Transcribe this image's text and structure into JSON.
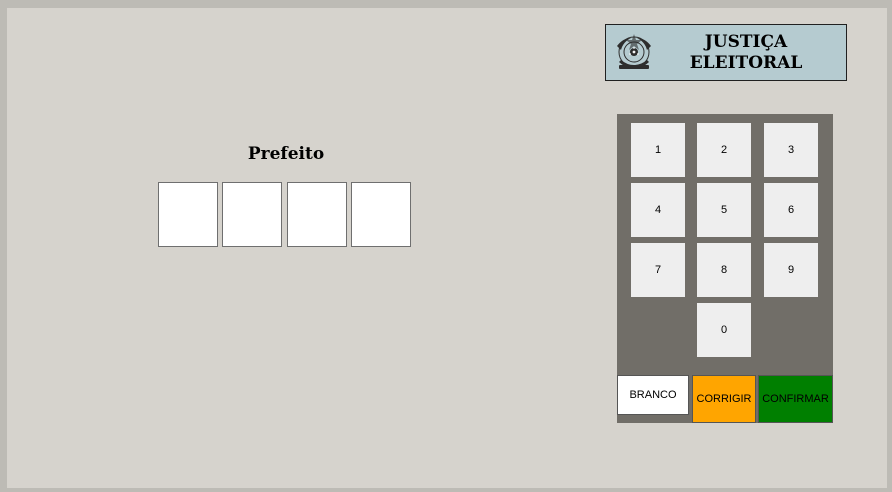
{
  "office": {
    "title": "Prefeito",
    "digits": [
      "",
      "",
      "",
      ""
    ]
  },
  "header": {
    "title_line1": "JUSTIÇA",
    "title_line2": "ELEITORAL",
    "seal_icon": "brasao-republica-icon"
  },
  "keypad": {
    "keys": [
      "1",
      "2",
      "3",
      "4",
      "5",
      "6",
      "7",
      "8",
      "9",
      "0"
    ]
  },
  "actions": {
    "branco": "BRANCO",
    "corrigir": "CORRIGIR",
    "confirmar": "CONFIRMAR"
  },
  "colors": {
    "screen_bg": "#d6d3cd",
    "header_bg": "#b5cbd0",
    "keypad_bg": "#716e68",
    "branco": "#ffffff",
    "corrigir": "#ffa500",
    "confirmar": "#007f00"
  }
}
